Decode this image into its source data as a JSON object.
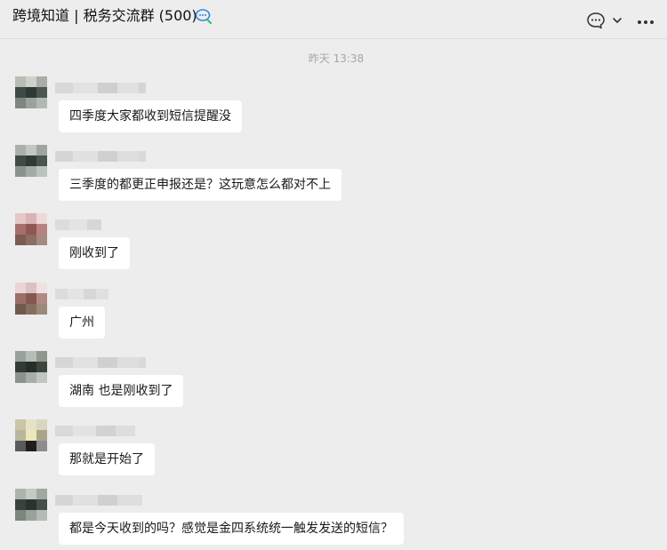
{
  "window": {
    "title": "跨境知道 | 税务交流群 (500)",
    "icons": {
      "title_icon": "chat-search-icon",
      "chat": "chat-bubble-icon",
      "chevron": "chevron-down-icon",
      "more": "more-icon"
    }
  },
  "chat": {
    "timestamp": "昨天 13:38",
    "messages": [
      {
        "text": "四季度大家都收到短信提醒没",
        "avatar_tones": [
          "#b9bdb4",
          "#cfd1cc",
          "#a9ada6",
          "#3f4a44",
          "#2d3a33",
          "#4b5650",
          "#7d8680",
          "#9aa29c",
          "#b3b8b4"
        ],
        "nick_tones": [
          "#d8d8d8",
          "#e2e2e2",
          "#cfcfcf",
          "#e0e0e0",
          "#d5d5d5"
        ]
      },
      {
        "text": "三季度的都更正申报还是？这玩意怎么都对不上",
        "avatar_tones": [
          "#aab1ab",
          "#c2c7c2",
          "#9ea59f",
          "#404b43",
          "#2f3a33",
          "#4a5550",
          "#8a938d",
          "#a3aba5",
          "#bcc2bd"
        ],
        "nick_tones": [
          "#d6d6d6",
          "#e1e1e1",
          "#d0d0d0",
          "#dedede",
          "#d9d9d9"
        ]
      },
      {
        "text": "刚收到了",
        "avatar_tones": [
          "#e6c7c7",
          "#d9b3b5",
          "#eed8d8",
          "#a86e6c",
          "#8f5752",
          "#b7837f",
          "#7c5c52",
          "#8c6d63",
          "#a48a80"
        ],
        "nick_tones": [
          "#dcdcdc",
          "#e4e4e4",
          "#d7d7d7"
        ]
      },
      {
        "text": "广州",
        "avatar_tones": [
          "#e8d5d8",
          "#dcc0c4",
          "#f0e0e2",
          "#9b6e6a",
          "#85584f",
          "#b08a82",
          "#6f5a4c",
          "#84705f",
          "#9b8a7b"
        ],
        "nick_tones": [
          "#dcdcdc",
          "#e4e4e4",
          "#d7d7d7",
          "#e0e0e0"
        ]
      },
      {
        "text": "湖南  也是刚收到了",
        "avatar_tones": [
          "#9aa39b",
          "#b7bdb6",
          "#8f978f",
          "#323c34",
          "#252e28",
          "#3c463f",
          "#8b938c",
          "#a7ada8",
          "#c0c5c1"
        ],
        "nick_tones": [
          "#d6d6d6",
          "#e1e1e1",
          "#d0d0d0",
          "#dedede",
          "#d9d9d9"
        ]
      },
      {
        "text": "那就是开始了",
        "avatar_tones": [
          "#c9c5a7",
          "#e7e2c4",
          "#d9d6c0",
          "#b9b79b",
          "#ece6b8",
          "#a9a48c",
          "#5a5a5a",
          "#1e1e1e",
          "#8c8c8c"
        ],
        "nick_tones": [
          "#d9d9d9",
          "#e3e3e3",
          "#d2d2d2",
          "#dedede"
        ]
      },
      {
        "text": "都是今天收到的吗？感觉是金四系统统一触发发送的短信？",
        "avatar_tones": [
          "#aeb3ad",
          "#c6cac5",
          "#a1a7a1",
          "#39433b",
          "#2a332d",
          "#46504a",
          "#7c857e",
          "#99a19b",
          "#b4bab5"
        ],
        "nick_tones": [
          "#d6d6d6",
          "#e1e1e1",
          "#d0d0d0",
          "#dedede"
        ]
      }
    ]
  }
}
